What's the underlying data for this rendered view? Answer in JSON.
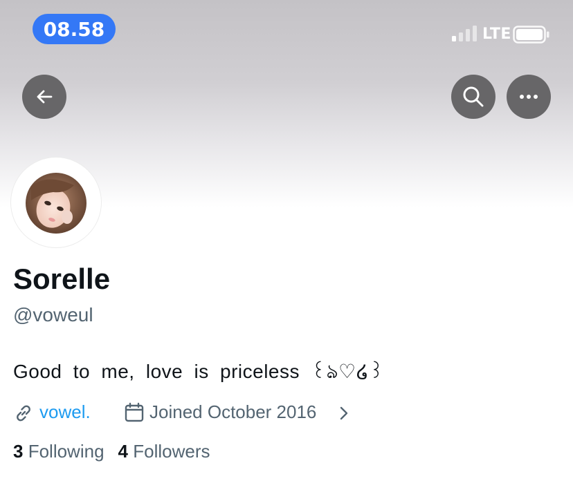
{
  "status_bar": {
    "time": "08.58",
    "network": "LTE"
  },
  "profile": {
    "display_name": "Sorelle",
    "handle": "@voweul",
    "bio": "Good to me, love is priceless ꒰ঌ♡໒꒱",
    "website": "vowel.",
    "joined": "Joined October 2016",
    "following_count": "3",
    "following_label": "Following",
    "followers_count": "4",
    "followers_label": "Followers"
  },
  "icons": {
    "back": "back-arrow-icon",
    "search": "search-icon",
    "more": "more-icon",
    "link": "link-icon",
    "calendar": "calendar-icon",
    "chevron": "chevron-right-icon"
  },
  "colors": {
    "time_pill": "#3478f6",
    "link": "#1d9bf0",
    "secondary_text": "#536471",
    "button_bg": "#676668"
  }
}
